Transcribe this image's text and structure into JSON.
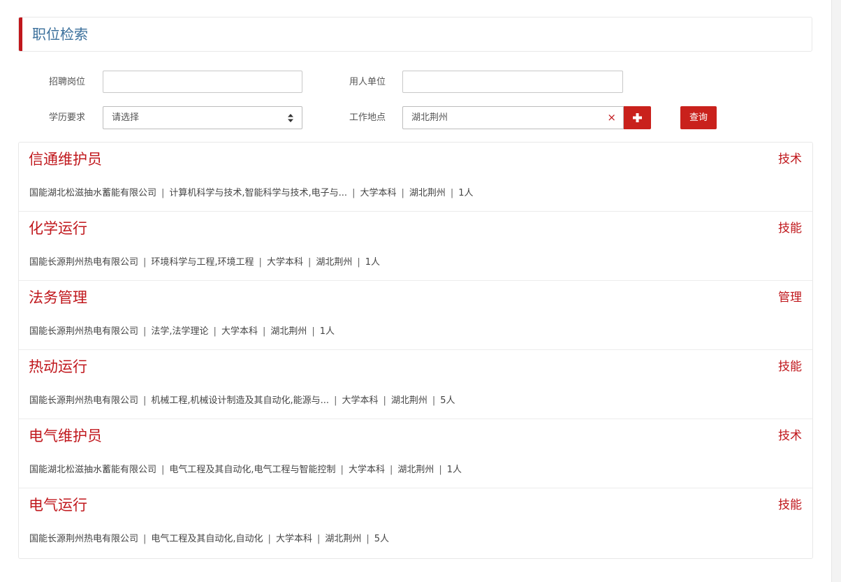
{
  "header": {
    "title": "职位检索"
  },
  "form": {
    "position_label": "招聘岗位",
    "position_value": "",
    "employer_label": "用人单位",
    "employer_value": "",
    "education_label": "学历要求",
    "education_selected": "请选择",
    "location_label": "工作地点",
    "location_value": "湖北荆州",
    "clear_symbol": "×",
    "query_label": "查询"
  },
  "colors": {
    "accent": "#c0171c",
    "title_blue": "#3a6f9b"
  },
  "jobs": [
    {
      "title": "信通维护员",
      "category": "技术",
      "company": "国能湖北松滋抽水蓄能有限公司",
      "majors": "计算机科学与技术,智能科学与技术,电子与...",
      "education": "大学本科",
      "location": "湖北荆州",
      "count": "1人"
    },
    {
      "title": "化学运行",
      "category": "技能",
      "company": "国能长源荆州热电有限公司",
      "majors": "环境科学与工程,环境工程",
      "education": "大学本科",
      "location": "湖北荆州",
      "count": "1人"
    },
    {
      "title": "法务管理",
      "category": "管理",
      "company": "国能长源荆州热电有限公司",
      "majors": "法学,法学理论",
      "education": "大学本科",
      "location": "湖北荆州",
      "count": "1人"
    },
    {
      "title": "热动运行",
      "category": "技能",
      "company": "国能长源荆州热电有限公司",
      "majors": "机械工程,机械设计制造及其自动化,能源与...",
      "education": "大学本科",
      "location": "湖北荆州",
      "count": "5人"
    },
    {
      "title": "电气维护员",
      "category": "技术",
      "company": "国能湖北松滋抽水蓄能有限公司",
      "majors": "电气工程及其自动化,电气工程与智能控制",
      "education": "大学本科",
      "location": "湖北荆州",
      "count": "1人"
    },
    {
      "title": "电气运行",
      "category": "技能",
      "company": "国能长源荆州热电有限公司",
      "majors": "电气工程及其自动化,自动化",
      "education": "大学本科",
      "location": "湖北荆州",
      "count": "5人"
    }
  ]
}
